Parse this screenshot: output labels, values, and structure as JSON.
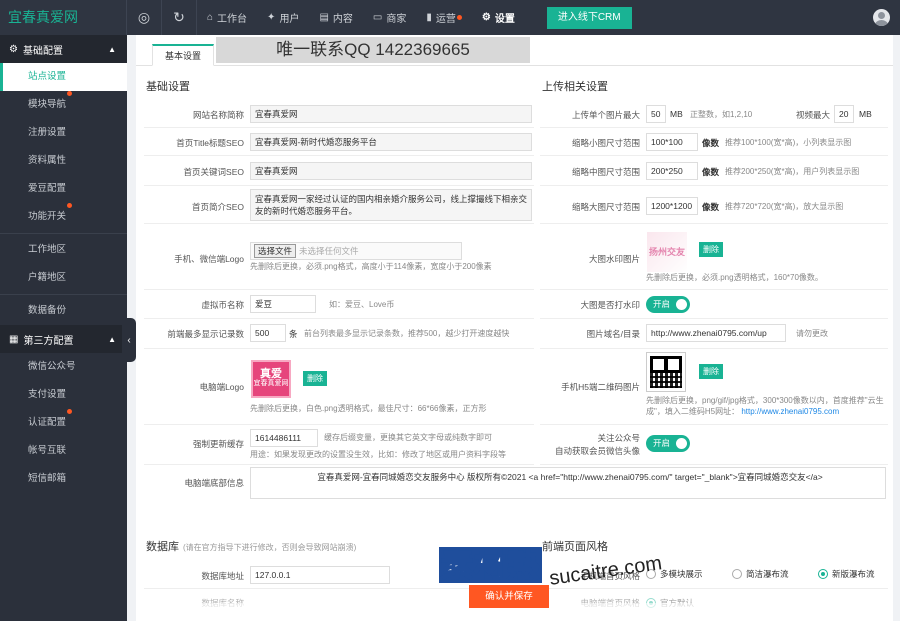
{
  "app": {
    "title": "宜春真爱网"
  },
  "topbar": {
    "nav": [
      {
        "icon": "home-icon",
        "label": "工作台",
        "glyph": "⌂",
        "dot": false,
        "active": false
      },
      {
        "icon": "user-icon",
        "label": "用户",
        "glyph": "✦",
        "dot": false,
        "active": false
      },
      {
        "icon": "content-icon",
        "label": "内容",
        "glyph": "▤",
        "dot": false,
        "active": false
      },
      {
        "icon": "shop-icon",
        "label": "商家",
        "glyph": "▭",
        "dot": false,
        "active": false
      },
      {
        "icon": "bar-chart-icon",
        "label": "运营",
        "glyph": "▮",
        "dot": true,
        "active": false
      },
      {
        "icon": "gear-icon",
        "label": "设置",
        "glyph": "⚙",
        "dot": false,
        "active": true
      }
    ],
    "crm_button": "进入线下CRM"
  },
  "sidebar": {
    "group1": {
      "title": "基础配置",
      "icon": "gear-icon"
    },
    "items1": [
      {
        "label": "站点设置",
        "active": true,
        "dot": false
      },
      {
        "label": "模块导航",
        "active": false,
        "dot": true
      },
      {
        "label": "注册设置",
        "active": false,
        "dot": false
      },
      {
        "label": "资料属性",
        "active": false,
        "dot": false
      },
      {
        "label": "爱豆配置",
        "active": false,
        "dot": false
      },
      {
        "label": "功能开关",
        "active": false,
        "dot": true
      }
    ],
    "items1b": [
      {
        "label": "工作地区",
        "active": false,
        "dot": false
      },
      {
        "label": "户籍地区",
        "active": false,
        "dot": false
      }
    ],
    "items1c": [
      {
        "label": "数据备份",
        "active": false,
        "dot": false
      }
    ],
    "group2": {
      "title": "第三方配置",
      "icon": "grid-icon"
    },
    "items2": [
      {
        "label": "微信公众号",
        "active": false,
        "dot": false
      },
      {
        "label": "支付设置",
        "active": false,
        "dot": false
      },
      {
        "label": "认证配置",
        "active": false,
        "dot": true
      },
      {
        "label": "帐号互联",
        "active": false,
        "dot": false
      },
      {
        "label": "短信邮箱",
        "active": false,
        "dot": false
      }
    ]
  },
  "main": {
    "tab": "基本设置",
    "banner": "唯一联系QQ 1422369665",
    "basic": {
      "title": "基础设置",
      "site_name_label": "网站名称简称",
      "site_name": "宜春真爱网",
      "home_title_label": "首页Title标题SEO",
      "home_title": "宜春真爱网-新时代婚恋服务平台",
      "keywords_label": "首页关键词SEO",
      "keywords": "宜春真爱网",
      "intro_label": "首页简介SEO",
      "intro": "宜春真爱网一家经过认证的国内相亲婚介服务公司，线上撑撮线下相亲交友的新时代婚恋服务平台。",
      "mobile_logo_label": "手机、微信端Logo",
      "file_button": "选择文件",
      "file_none": "未选择任何文件",
      "mobile_logo_hint": "先删除后更换，必须.png格式，高度小于114像素，宽度小于200像素",
      "currency_label": "虚拟币名称",
      "currency": "爱豆",
      "currency_hint": "如：爱豆、Love币",
      "front_max_label": "前端最多显示记录数",
      "front_max": "500",
      "front_max_unit": "条",
      "front_max_hint": "前台列表最多显示记录条数，推荐500，越少打开速度越快",
      "pc_logo_label": "电脑端Logo",
      "pc_logo_text": "真爱",
      "pc_logo_sub": "宜春真爱网",
      "delete": "删除",
      "pc_logo_hint": "先删除后更换，白色.png透明格式，最佳尺寸：66*66像素，正方形",
      "cache_label": "强制更新缓存",
      "cache_value": "1614486111",
      "cache_hint": "缓存后缀变量，更换其它英文字母或纯数字即可",
      "cache_hint2": "用途：如果发现更改的设置没生效，比如：修改了地区或用户资料字段等",
      "footer_label": "电脑端底部信息",
      "footer_value": "宜春真爱网-宜春同城婚恋交友服务中心   版权所有©2021   <a href=\"http://www.zhenai0795.com/\" target=\"_blank\">宜春同城婚恋交友</a>"
    },
    "upload": {
      "title": "上传相关设置",
      "max_size_label": "上传单个图片最大",
      "max_size": "50",
      "max_size_unit": "MB",
      "max_size_hint": "正整数，如1,2,10",
      "video_label": "视频最大",
      "video_max": "20",
      "video_unit": "MB",
      "thumb_s_label": "缩略小图尺寸范围",
      "thumb_s": "100*100",
      "thumb_s_hint": "推荐100*100(宽*高)，小列表显示图",
      "thumb_m_label": "缩略中图尺寸范围",
      "thumb_m": "200*250",
      "thumb_m_hint": "推荐200*250(宽*高)，用户列表显示图",
      "thumb_l_label": "缩略大图尺寸范围",
      "thumb_l": "1200*1200",
      "thumb_l_hint": "推荐720*720(宽*高)，放大显示图",
      "px_unit": "像数",
      "watermark_label": "大图水印图片",
      "watermark_text": "扬州交友",
      "watermark_hint": "先删除后更换，必须.png透明格式，160*70像数。",
      "wm_switch_label": "大图是否打水印",
      "on": "开启",
      "domain_label": "图片域名/目录",
      "domain": "http://www.zhenai0795.com/up",
      "domain_hint": "请勿更改",
      "h5_qr_label": "手机H5端二维码图片",
      "h5_qr_hint": "先删除后更换，png/gif/jpg格式，300*300像数以内，首度推荐\"云生成\"，填入二维码H5网址：",
      "h5_qr_link": "http://www.zhenai0795.com",
      "mp_label": "关注公众号",
      "mp_label2": "自动获取会员微信头像"
    },
    "db": {
      "title": "数据库",
      "title_note": "(请在官方指导下进行修改，否则会导致网站崩溃)",
      "host_label": "数据库地址",
      "host": "127.0.0.1",
      "name_label": "数据库名称"
    },
    "style": {
      "title": "前端页面风格",
      "mobile_label": "手机端首页风格",
      "opt1": "多模块展示",
      "opt2": "简洁瀑布流",
      "opt3": "新版瀑布流",
      "pc_label": "电脑端首页风格",
      "pc_opt1": "官方默认"
    },
    "save_button": "确认并保存"
  },
  "watermark": {
    "chars": "素材熱",
    "latin": "sucaitre.com"
  },
  "colors": {
    "accent": "#19b394",
    "danger": "#ff5722",
    "sidebar": "#2b303b",
    "topbar": "#2f3541"
  }
}
